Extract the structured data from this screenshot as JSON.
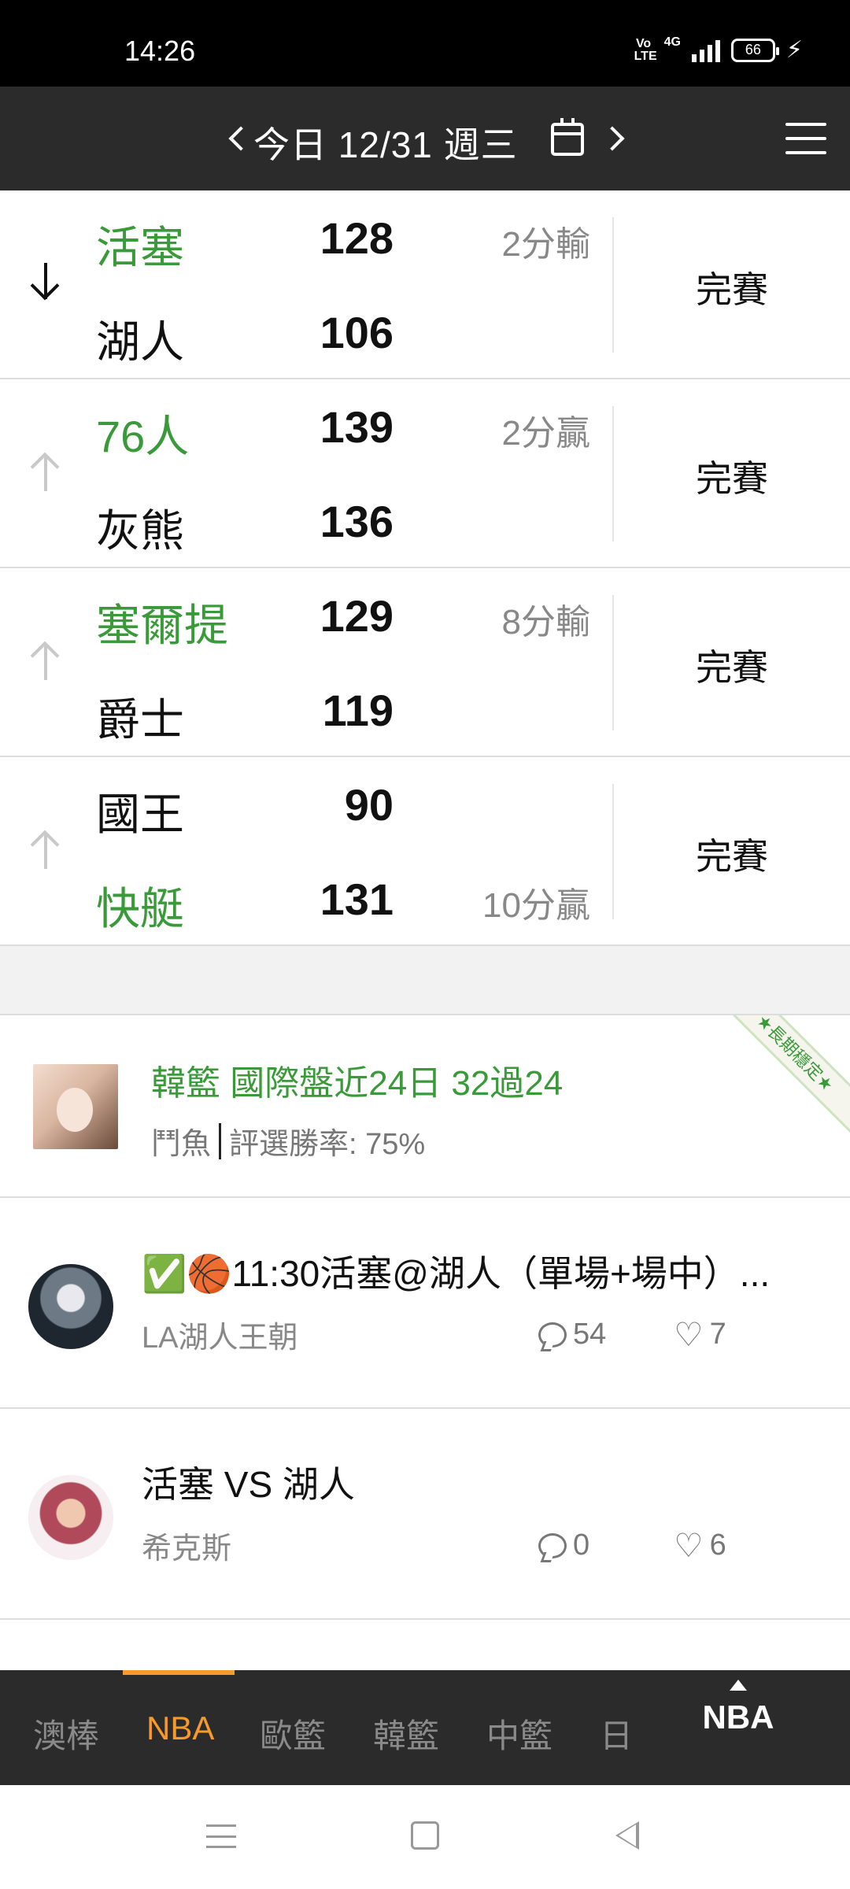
{
  "status_bar": {
    "time": "14:26",
    "volte": "Vo LTE",
    "network": "4G",
    "battery": "66"
  },
  "header": {
    "title": "今日 12/31 週三",
    "prev_icon": "chevron-left-icon",
    "next_icon": "chevron-right-icon",
    "calendar_icon": "calendar-icon",
    "menu_icon": "hamburger-menu-icon"
  },
  "games": [
    {
      "trend": "down",
      "team_top": "活塞",
      "score_top": "128",
      "spread_top": "2分輸",
      "top_win": true,
      "team_bottom": "湖人",
      "score_bottom": "106",
      "spread_bottom": "",
      "bottom_win": false,
      "status": "完賽"
    },
    {
      "trend": "up",
      "team_top": "76人",
      "score_top": "139",
      "spread_top": "2分贏",
      "top_win": true,
      "team_bottom": "灰熊",
      "score_bottom": "136",
      "spread_bottom": "",
      "bottom_win": false,
      "status": "完賽"
    },
    {
      "trend": "up",
      "team_top": "塞爾提",
      "score_top": "129",
      "spread_top": "8分輸",
      "top_win": true,
      "team_bottom": "爵士",
      "score_bottom": "119",
      "spread_bottom": "",
      "bottom_win": false,
      "status": "完賽"
    },
    {
      "trend": "up",
      "team_top": "國王",
      "score_top": "90",
      "spread_top": "",
      "top_win": false,
      "team_bottom": "快艇",
      "score_bottom": "131",
      "spread_bottom": "10分贏",
      "bottom_win": true,
      "status": "完賽"
    }
  ],
  "posts": {
    "featured": {
      "title": "韓籃 國際盤近24日 32過24",
      "author": "鬥魚",
      "win_rate": "評選勝率: 75%",
      "ribbon": "★長期穩定★"
    },
    "items": [
      {
        "title": "✅🏀11:30活塞@湖人（單場+場中）...",
        "author": "LA湖人王朝",
        "comments": "54",
        "likes": "7"
      },
      {
        "title": "活塞 VS 湖人",
        "author": "希克斯",
        "comments": "0",
        "likes": "6"
      }
    ]
  },
  "bottom_nav": {
    "tabs": [
      "澳棒",
      "NBA",
      "歐籃",
      "韓籃",
      "中籃",
      "日"
    ],
    "active_index": 1,
    "pinned": "NBA"
  },
  "colors": {
    "winner_green": "#3a9a3a",
    "active_orange": "#f59a2b",
    "bar_dark": "#2b2b2b"
  }
}
